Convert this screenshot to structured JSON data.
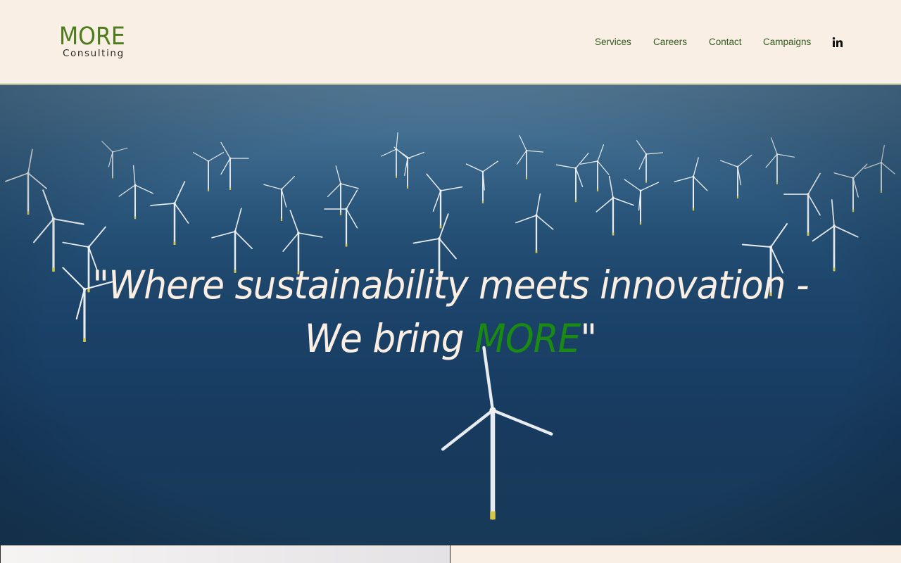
{
  "header": {
    "logo_main": "MORE",
    "logo_sub": "Consulting",
    "nav": [
      {
        "label": "Services"
      },
      {
        "label": "Careers"
      },
      {
        "label": "Contact"
      },
      {
        "label": "Campaigns"
      }
    ],
    "social_icon": "linkedin-icon"
  },
  "hero": {
    "quote_line1": "\"Where sustainability meets innovation -",
    "quote_line2_prefix": "We bring ",
    "quote_accent": "MORE",
    "quote_line2_suffix": "\"",
    "background": "offshore-wind-farm-photo"
  },
  "colors": {
    "background": "#faefe5",
    "brand_green": "#4d7c1c",
    "nav_text": "#2f5a1a",
    "accent_green": "#1a8a12",
    "quote_text": "#fbefe4"
  }
}
